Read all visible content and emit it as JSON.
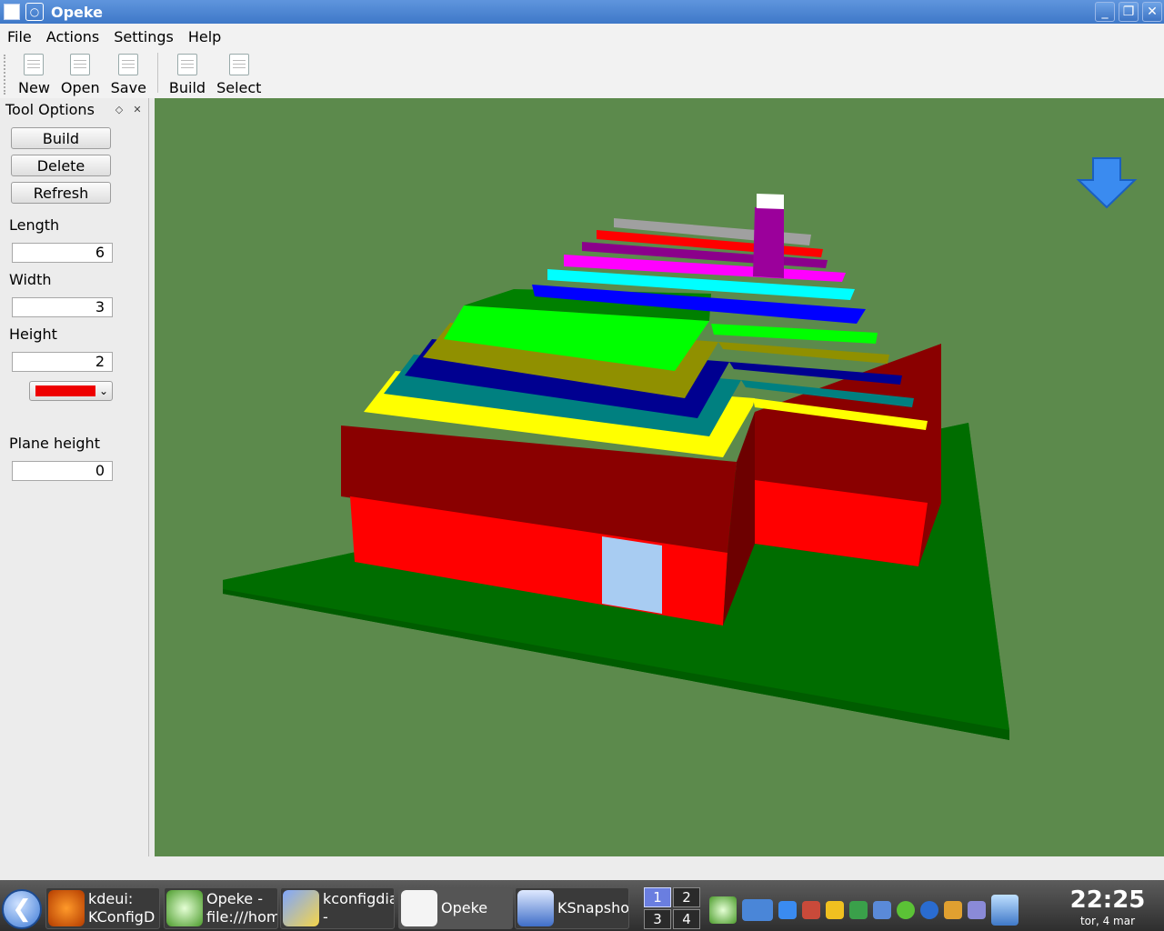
{
  "window": {
    "title": "Opeke"
  },
  "menu": [
    "File",
    "Actions",
    "Settings",
    "Help"
  ],
  "toolbar": [
    {
      "label": "New",
      "icon": "new-document-icon"
    },
    {
      "label": "Open",
      "icon": "open-document-icon"
    },
    {
      "label": "Save",
      "icon": "save-document-icon"
    },
    {
      "label": "Build",
      "icon": "build-icon"
    },
    {
      "label": "Select",
      "icon": "select-icon"
    }
  ],
  "tool_options": {
    "title": "Tool Options",
    "build_button": "Build",
    "delete_button": "Delete",
    "refresh_button": "Refresh",
    "length_label": "Length",
    "length_value": "6",
    "width_label": "Width",
    "width_value": "3",
    "height_label": "Height",
    "height_value": "2",
    "color": "#ee0000",
    "plane_height_label": "Plane height",
    "plane_height_value": "0"
  },
  "taskbar": {
    "tasks": [
      {
        "text": "kdeui:\nKConfigD\nCl...",
        "icon": "firefox-icon"
      },
      {
        "text": "Opeke -\nfile:///home",
        "icon": "konqueror-icon"
      },
      {
        "text": "kconfigdia\n-\nK...",
        "icon": "kate-icon"
      },
      {
        "text": "Opeke",
        "icon": "opeke-icon"
      },
      {
        "text": "KSnapsho",
        "icon": "ksnapshot-icon"
      }
    ],
    "pager": [
      "1",
      "2",
      "3",
      "4"
    ],
    "active_desktop": "1",
    "clock_time": "22:25",
    "clock_date": "tor, 4 mar"
  }
}
